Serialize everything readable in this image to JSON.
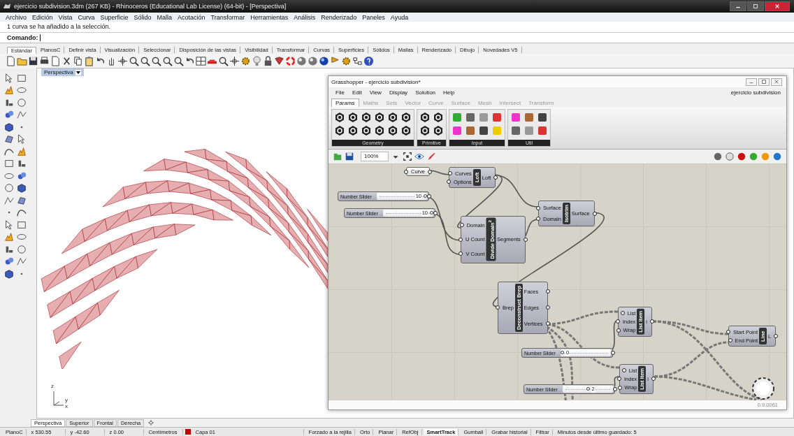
{
  "window": {
    "title": "ejercicio subdivision.3dm (267 KB) - Rhinoceros (Educational Lab License) (64-bit) - [Perspectiva]"
  },
  "menu": [
    "Archivo",
    "Edición",
    "Vista",
    "Curva",
    "Superficie",
    "Sólido",
    "Malla",
    "Acotación",
    "Transformar",
    "Herramientas",
    "Análisis",
    "Renderizado",
    "Paneles",
    "Ayuda"
  ],
  "command_history": "1 curva se ha añadido a la selección.",
  "command_prompt": "Comando:",
  "toolbar_tabs": [
    {
      "label": "Estándar",
      "selected": true
    },
    {
      "label": "PlanosC",
      "selected": false
    },
    {
      "label": "Definir vista",
      "selected": false
    },
    {
      "label": "Visualización",
      "selected": false
    },
    {
      "label": "Seleccionar",
      "selected": false
    },
    {
      "label": "Disposición de las vistas",
      "selected": false
    },
    {
      "label": "Visibilidad",
      "selected": false
    },
    {
      "label": "Transformar",
      "selected": false
    },
    {
      "label": "Curvas",
      "selected": false
    },
    {
      "label": "Superficies",
      "selected": false
    },
    {
      "label": "Sólidos",
      "selected": false
    },
    {
      "label": "Mallas",
      "selected": false
    },
    {
      "label": "Renderizado",
      "selected": false
    },
    {
      "label": "Dibujo",
      "selected": false
    },
    {
      "label": "Novedades V5",
      "selected": false
    }
  ],
  "viewport": {
    "label": "Perspectiva",
    "axis_labels": [
      "z",
      "y",
      "x"
    ]
  },
  "grasshopper": {
    "title": "Grasshopper - ejercicio subdivision*",
    "menu": [
      "File",
      "Edit",
      "View",
      "Display",
      "Solution",
      "Help"
    ],
    "document": "ejercicio subdivision",
    "tabs": [
      {
        "label": "Params",
        "selected": true
      },
      {
        "label": "Maths",
        "selected": false
      },
      {
        "label": "Sets",
        "selected": false
      },
      {
        "label": "Vector",
        "selected": false
      },
      {
        "label": "Curve",
        "selected": false
      },
      {
        "label": "Surface",
        "selected": false
      },
      {
        "label": "Mesh",
        "selected": false
      },
      {
        "label": "Intersect",
        "selected": false
      },
      {
        "label": "Transform",
        "selected": false
      }
    ],
    "ribbon_groups": [
      "Geometry",
      "Primitive",
      "Input",
      "Util"
    ],
    "zoom": "100%",
    "nodes": [
      {
        "kind": "param",
        "label": "Curve"
      },
      {
        "kind": "component",
        "name": "Loft",
        "inputs": [
          "Curves",
          "Options"
        ],
        "outputs": [
          "Loft"
        ]
      },
      {
        "kind": "slider",
        "label": "Number Slider",
        "value": "10",
        "level": 1
      },
      {
        "kind": "slider",
        "label": "Number Slider",
        "value": "10",
        "level": 1
      },
      {
        "kind": "component",
        "name": "Divide Domain$^{2}$",
        "inputs": [
          "Domain",
          "U Count",
          "V Count"
        ],
        "outputs": [
          "Segments"
        ]
      },
      {
        "kind": "component",
        "name": "Isotrim",
        "inputs": [
          "Surface",
          "Domain"
        ],
        "outputs": [
          "Surface"
        ]
      },
      {
        "kind": "component",
        "name": "Deconstruct Brep",
        "inputs": [
          "Brep"
        ],
        "outputs": [
          "Faces",
          "Edges",
          "Vertices"
        ]
      },
      {
        "kind": "component",
        "name": "List Item",
        "inputs": [
          "List",
          "Index",
          "Wrap"
        ],
        "outputs": [
          "i"
        ]
      },
      {
        "kind": "slider",
        "label": "Number Slider",
        "value": "0",
        "level": 0
      },
      {
        "kind": "component",
        "name": "List Item",
        "inputs": [
          "List",
          "Index",
          "Wrap"
        ],
        "outputs": [
          "i"
        ]
      },
      {
        "kind": "slider",
        "label": "Number Slider",
        "value": "2",
        "level": 0.5
      },
      {
        "kind": "component",
        "name": "Line",
        "inputs": [
          "Start Point",
          "End Point"
        ],
        "outputs": [
          "L"
        ]
      }
    ],
    "version": "0.9.0061"
  },
  "viewport_tabs": [
    {
      "label": "Perspectiva",
      "selected": true
    },
    {
      "label": "Superior",
      "selected": false
    },
    {
      "label": "Frontal",
      "selected": false
    },
    {
      "label": "Derecha",
      "selected": false
    }
  ],
  "status_bar": {
    "cplane": "PlanoC",
    "x": "x 530.55",
    "y": "y -42.60",
    "z": "z 0.00",
    "units": "Centímetros",
    "layer": {
      "name": "Capa 01",
      "color": "#c00000"
    },
    "toggles": [
      {
        "label": "Forzado a la rejilla",
        "on": false
      },
      {
        "label": "Orto",
        "on": false
      },
      {
        "label": "Planar",
        "on": false
      },
      {
        "label": "RefObj",
        "on": false
      },
      {
        "label": "SmartTrack",
        "on": true
      },
      {
        "label": "Gumball",
        "on": false
      },
      {
        "label": "Grabar historial",
        "on": false
      },
      {
        "label": "Filtrar",
        "on": false
      }
    ],
    "message": "Minutos desde último guardado: 5"
  }
}
